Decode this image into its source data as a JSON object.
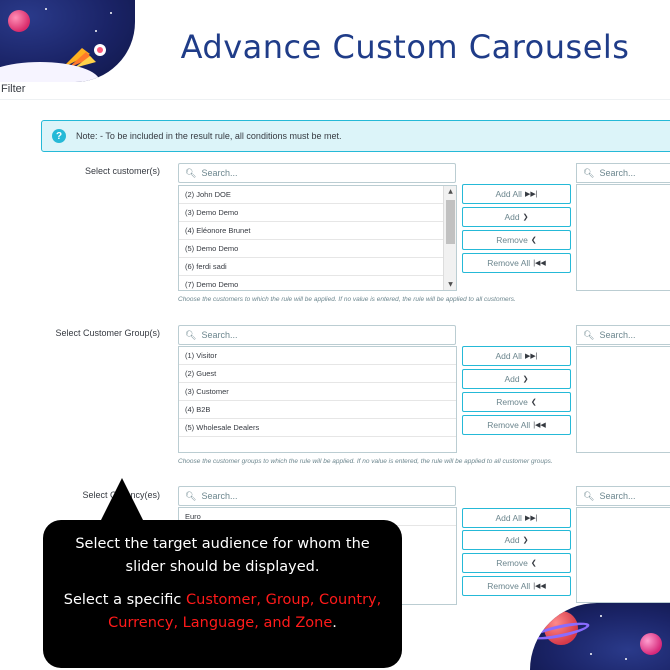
{
  "header": {
    "title": "Advance Custom Carousels"
  },
  "filter": {
    "label": "Filter"
  },
  "notice": {
    "icon": "question-circle-icon",
    "text": "Note: - To be included in the result rule, all conditions must be met."
  },
  "sections": {
    "customers": {
      "label": "Select customer(s)",
      "search_placeholder": "Search...",
      "right_search_placeholder": "Search...",
      "items": [
        "(2) John DOE",
        "(3) Demo Demo",
        "(4) Eléonore Brunet",
        "(5) Demo Demo",
        "(6) ferdi sadi",
        "(7) Demo Demo"
      ],
      "help": "Choose the customers to which the rule will be applied. If no value is entered, the rule will be applied to all customers."
    },
    "groups": {
      "label": "Select Customer Group(s)",
      "search_placeholder": "Search...",
      "right_search_placeholder": "Search...",
      "items": [
        "(1) Visitor",
        "(2) Guest",
        "(3) Customer",
        "(4) B2B",
        "(5) Wholesale Dealers"
      ],
      "help": "Choose the customer groups to which the rule will be applied. If no value is entered, the rule will be applied to all customer groups."
    },
    "currencies": {
      "label_start": "Select C",
      "label_end": "ncy(es)",
      "search_placeholder": "Search...",
      "right_search_placeholder": "Search...",
      "items": [
        "Euro"
      ]
    }
  },
  "buttons": {
    "add_all": "Add All",
    "add": "Add",
    "remove": "Remove",
    "remove_all": "Remove All"
  },
  "callout": {
    "line1": "Select the target audience for whom the slider should be displayed.",
    "line2_prefix": "Select a specific ",
    "line2_highlight": "Customer, Group, Country, Currency, Language, and Zone",
    "line2_suffix": "."
  }
}
